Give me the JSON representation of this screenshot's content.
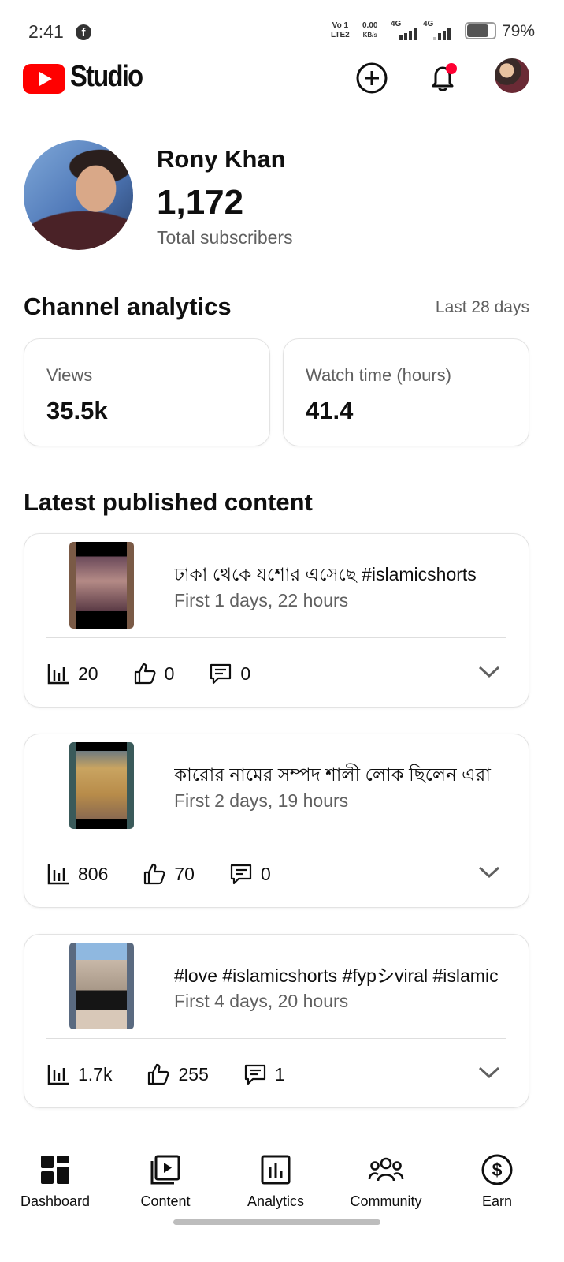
{
  "status_bar": {
    "time": "2:41",
    "net1": "Vo 1",
    "net1b": "LTE2",
    "speed": "0.00",
    "speed_unit": "KB/s",
    "net_a": "4G",
    "net_b": "4G",
    "battery": "79%",
    "battery_level": 0.79
  },
  "header": {
    "logo_text": "Studio",
    "brand_color": "#ff0000",
    "icons": [
      "add-icon",
      "notification-bell-icon",
      "avatar"
    ]
  },
  "profile": {
    "name": "Rony Khan",
    "subscribers": "1,172",
    "subscribers_label": "Total subscribers"
  },
  "analytics": {
    "title": "Channel analytics",
    "period": "Last 28 days",
    "cards": [
      {
        "label": "Views",
        "value": "35.5k"
      },
      {
        "label": "Watch time (hours)",
        "value": "41.4"
      }
    ]
  },
  "latest": {
    "title": "Latest published content",
    "items": [
      {
        "title": "ঢাকা থেকে যশোর এসেছে #islamicshorts",
        "subtitle": "First 1 days, 22 hours",
        "views": "20",
        "likes": "0",
        "comments": "0"
      },
      {
        "title": "কারোর নামের সম্পদ শালী লোক ছিলেন এরা",
        "subtitle": "First 2 days, 19 hours",
        "views": "806",
        "likes": "70",
        "comments": "0"
      },
      {
        "title": "#love #islamicshorts #fypシviral #islamic",
        "subtitle": "First 4 days, 20 hours",
        "views": "1.7k",
        "likes": "255",
        "comments": "1"
      }
    ]
  },
  "nav": {
    "items": [
      {
        "label": "Dashboard",
        "icon": "dashboard-icon"
      },
      {
        "label": "Content",
        "icon": "content-icon"
      },
      {
        "label": "Analytics",
        "icon": "analytics-icon"
      },
      {
        "label": "Community",
        "icon": "community-icon"
      },
      {
        "label": "Earn",
        "icon": "earn-icon"
      }
    ]
  }
}
